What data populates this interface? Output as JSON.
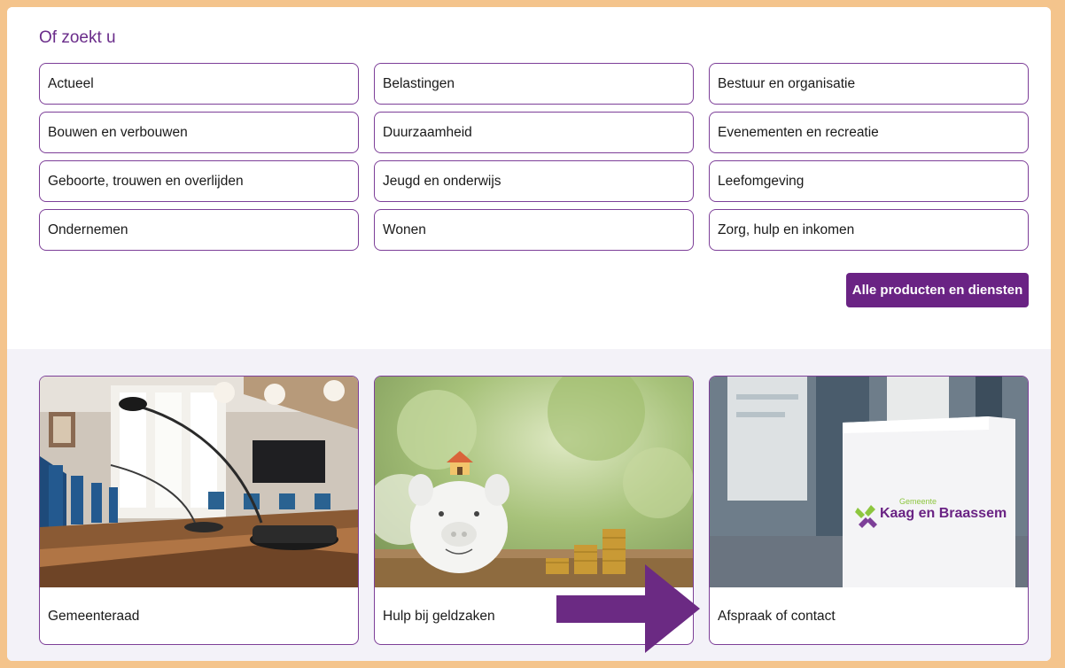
{
  "section": {
    "heading": "Of zoekt u"
  },
  "links": [
    "Actueel",
    "Belastingen",
    "Bestuur en organisatie",
    "Bouwen en verbouwen",
    "Duurzaamheid",
    "Evenementen en recreatie",
    "Geboorte, trouwen en overlijden",
    "Jeugd en onderwijs",
    "Leefomgeving",
    "Ondernemen",
    "Wonen",
    "Zorg, hulp en inkomen"
  ],
  "all_button": "Alle producten en diensten",
  "cards": [
    {
      "label": "Gemeenteraad"
    },
    {
      "label": "Hulp bij geldzaken"
    },
    {
      "label": "Afspraak of contact"
    }
  ],
  "logo": {
    "line1": "Gemeente",
    "line2": "Kaag en Braassem"
  },
  "colors": {
    "accent": "#6a2384",
    "border": "#7d3f98",
    "frame": "#f4c48c",
    "logo_green": "#8dc63f"
  }
}
